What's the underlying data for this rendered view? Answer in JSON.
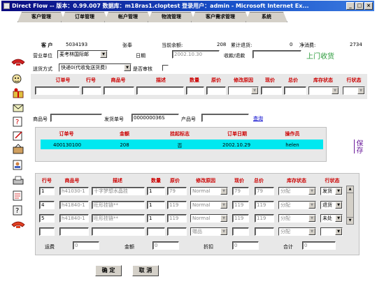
{
  "window": {
    "title": "Direct Flow -- 版本：0.99.007 数据库：m18ras1.cloptest 登录用户：admin - Microsoft Internet Ex...",
    "min": "_",
    "max": "□",
    "close": "×"
  },
  "tabs": [
    "客户管理",
    "订单管理",
    "帐户管理",
    "物流管理",
    "客户需求管理",
    "系统"
  ],
  "customer": {
    "label": "客 户",
    "code": "5034193",
    "name": "张奉",
    "balance_label": "当前余额:",
    "balance": "208",
    "returns_label": "累计退货:",
    "returns": "0",
    "net_label": "净消费:",
    "net": "2734"
  },
  "business_unit": {
    "label": "营业单位",
    "value": "麦考林国际邮"
  },
  "date": {
    "label": "日期",
    "value": "2002.10.30"
  },
  "receipt": {
    "label": "收款/退款",
    "link": "上门收货"
  },
  "shipping": {
    "label": "送货方式",
    "value": "快递0(代收免送货费)",
    "audit_label": "是否审核"
  },
  "order_cols": [
    "订单号",
    "行号",
    "商品号",
    "描述",
    "数量",
    "原价",
    "修改原因",
    "现价",
    "总价",
    "库存状态",
    "行状态"
  ],
  "search": {
    "product_label": "商品号",
    "ship_label": "发货单号",
    "ship_value": "000000036S",
    "product2_label": "产品号",
    "query": "查询"
  },
  "pending_cols": [
    "订单号",
    "金额",
    "挂起标志",
    "订单日期",
    "操作员"
  ],
  "pending_row": [
    "400130100",
    "208",
    "否",
    "2002.10.29",
    "helen"
  ],
  "save_link": "保存",
  "line_cols": [
    "行号",
    "商品号",
    "描述",
    "数量",
    "原价",
    "修改原因",
    "现价",
    "总价",
    "库存状态",
    "行状态"
  ],
  "lines": [
    {
      "no": "1",
      "sku": "h41030-1",
      "desc": "十字梦想水晶挂",
      "qty": "1",
      "price": "79",
      "reason": "Normal",
      "cur": "79",
      "total": "79",
      "stock": "分配",
      "status": "发货"
    },
    {
      "no": "4",
      "sku": "h41840-1",
      "desc": "旺形挂链**",
      "qty": "1",
      "price": "119",
      "reason": "Normal",
      "cur": "119",
      "total": "119",
      "stock": "分配",
      "status": "退货"
    },
    {
      "no": "5",
      "sku": "h41840-1",
      "desc": "旺形挂链**",
      "qty": "1",
      "price": "119",
      "reason": "Normal",
      "cur": "119",
      "total": "119",
      "stock": "分配",
      "status": "未处"
    },
    {
      "no": "",
      "sku": "",
      "desc": "",
      "qty": "",
      "price": "",
      "reason": "赠品",
      "cur": "",
      "total": "",
      "stock": "分配",
      "status": ""
    }
  ],
  "totals": {
    "freight_label": "运费",
    "freight": "0",
    "amount_label": "金额",
    "amount": "0",
    "discount_label": "折扣",
    "discount": "0",
    "sum_label": "合计",
    "sum": "0"
  },
  "buttons": {
    "ok": "确 定",
    "cancel": "取 消"
  },
  "colors": {
    "accent_red": "#cc0000",
    "highlight_cyan": "#00e8f0",
    "title_blue": "#0a0a80"
  }
}
